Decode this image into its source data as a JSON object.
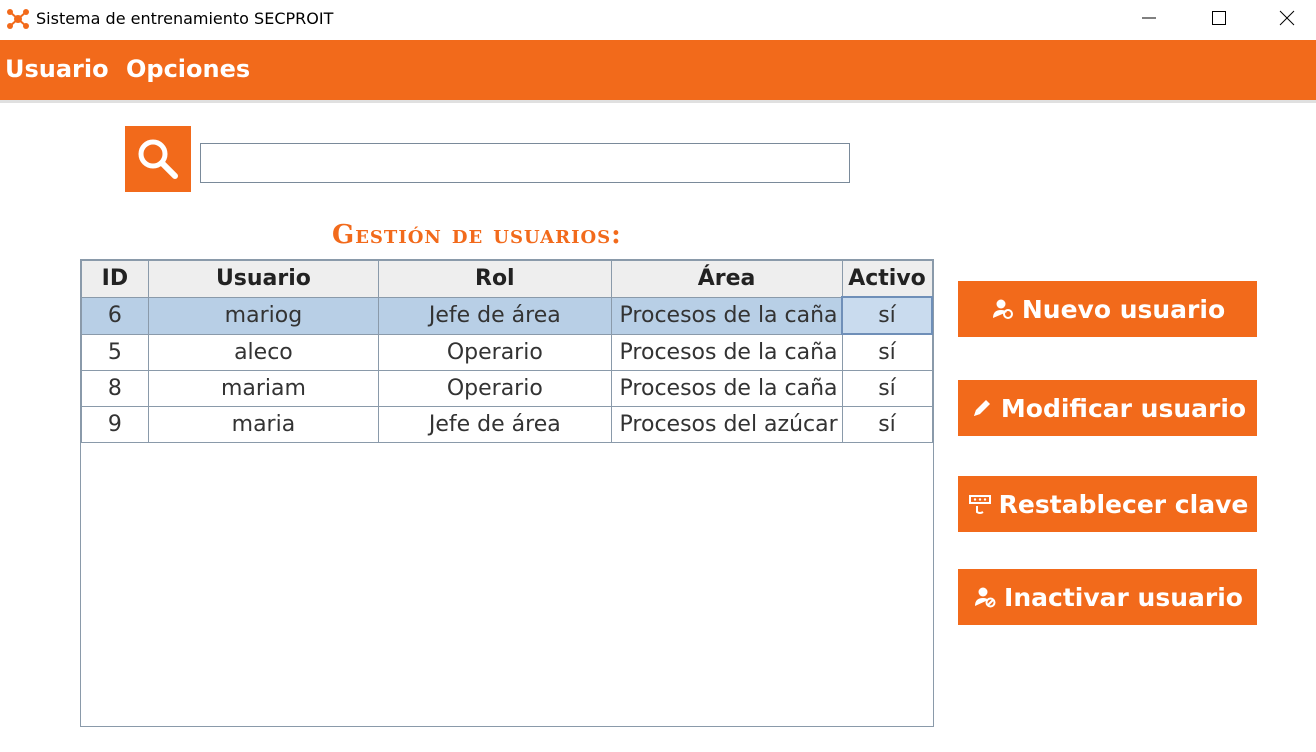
{
  "window": {
    "title": "Sistema de entrenamiento SECPROIT"
  },
  "menu": {
    "items": [
      "Usuario",
      "Opciones"
    ]
  },
  "search": {
    "value": "",
    "placeholder": ""
  },
  "section_title": "Gestión de usuarios:",
  "table": {
    "columns": [
      "ID",
      "Usuario",
      "Rol",
      "Área",
      "Activo"
    ],
    "rows": [
      {
        "id": "6",
        "usuario": "mariog",
        "rol": "Jefe de área",
        "area": "Procesos de la caña",
        "activo": "sí",
        "selected": true
      },
      {
        "id": "5",
        "usuario": "aleco",
        "rol": "Operario",
        "area": "Procesos de la caña",
        "activo": "sí",
        "selected": false
      },
      {
        "id": "8",
        "usuario": "mariam",
        "rol": "Operario",
        "area": "Procesos de la caña",
        "activo": "sí",
        "selected": false
      },
      {
        "id": "9",
        "usuario": "maria",
        "rol": "Jefe de área",
        "area": "Procesos del azúcar",
        "activo": "sí",
        "selected": false
      }
    ]
  },
  "actions": {
    "new_user": {
      "label": "Nuevo usuario",
      "icon": "user-add-icon"
    },
    "modify_user": {
      "label": "Modificar usuario",
      "icon": "pencil-icon"
    },
    "reset_password": {
      "label": "Restablecer clave",
      "icon": "password-icon"
    },
    "deactivate_user": {
      "label": "Inactivar usuario",
      "icon": "user-deactivate-icon"
    }
  },
  "colors": {
    "accent": "#f26a1b",
    "selection": "#b8cfe6",
    "header_bg": "#eeeeee"
  }
}
